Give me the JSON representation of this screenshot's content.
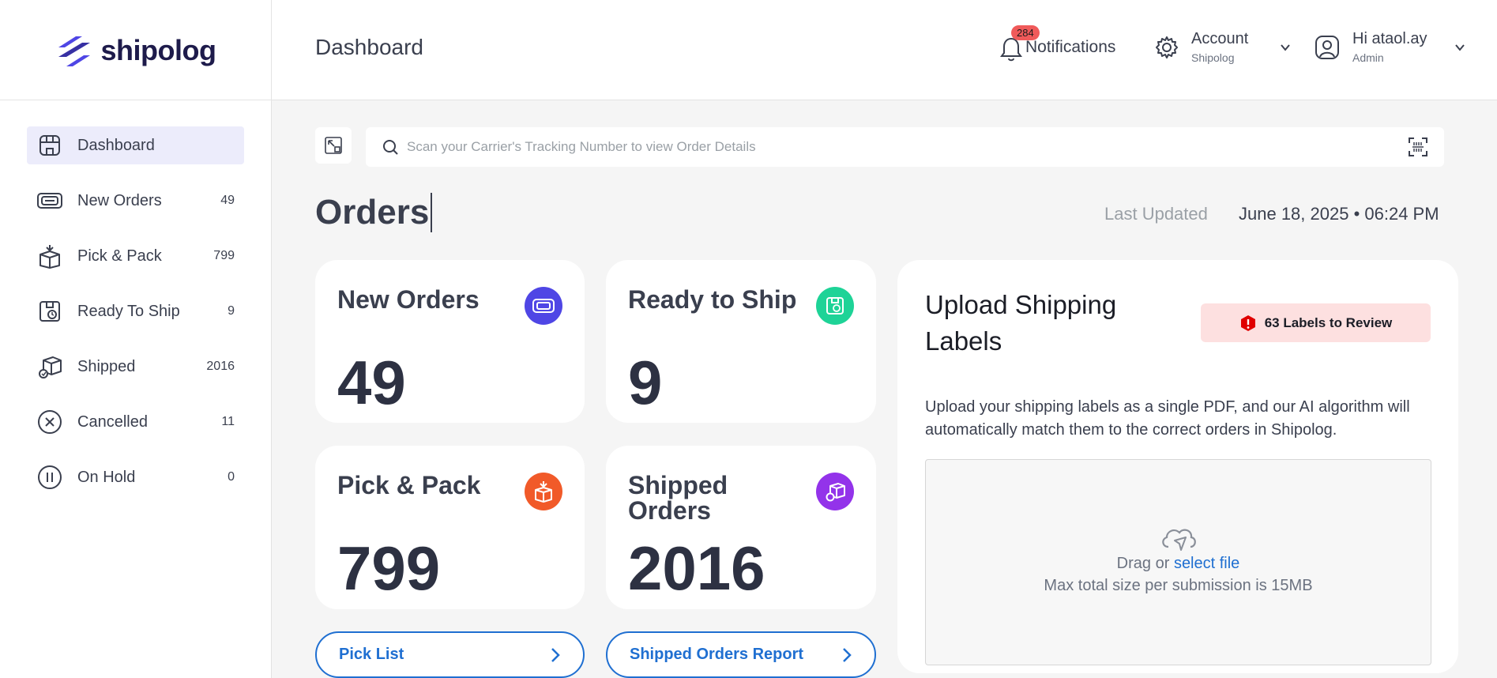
{
  "brand": {
    "name": "shipolog"
  },
  "header": {
    "title": "Dashboard",
    "notifications": {
      "count": "284",
      "label": "Notifications"
    },
    "account": {
      "label": "Account",
      "sub": "Shipolog"
    },
    "user": {
      "greeting": "Hi ataol.ay",
      "role": "Admin"
    }
  },
  "sidebar": {
    "items": [
      {
        "label": "Dashboard",
        "count": "",
        "icon": "store-icon"
      },
      {
        "label": "New Orders",
        "count": "49",
        "icon": "ticket-icon"
      },
      {
        "label": "Pick & Pack",
        "count": "799",
        "icon": "box-icon"
      },
      {
        "label": "Ready To Ship",
        "count": "9",
        "icon": "clock-box-icon"
      },
      {
        "label": "Shipped",
        "count": "2016",
        "icon": "shipped-box-icon"
      },
      {
        "label": "Cancelled",
        "count": "11",
        "icon": "x-circle-icon"
      },
      {
        "label": "On Hold",
        "count": "0",
        "icon": "pause-circle-icon"
      }
    ]
  },
  "search": {
    "placeholder": "Scan your Carrier's Tracking Number to view Order Details"
  },
  "orders": {
    "heading": "Orders",
    "last_updated_label": "Last Updated",
    "last_updated_value": "June 18, 2025 • 06:24 PM",
    "cards": [
      {
        "title": "New Orders",
        "value": "49",
        "color": "#4f46e5"
      },
      {
        "title": "Ready to Ship",
        "value": "9",
        "color": "#1ed397"
      },
      {
        "title": "Pick & Pack",
        "value": "799",
        "color": "#f15a29"
      },
      {
        "title": "Shipped Orders",
        "value": "2016",
        "color": "#9333ea"
      }
    ],
    "links": [
      {
        "label": "Pick List"
      },
      {
        "label": "Shipped Orders Report"
      }
    ]
  },
  "upload": {
    "title": "Upload Shipping Labels",
    "review_label": "63 Labels to Review",
    "description": "Upload your shipping labels as a single PDF, and our AI algorithm will automatically match them to the correct orders in Shipolog.",
    "drag_text": "Drag or",
    "select_text": "select file",
    "max_text": "Max total size per submission is 15MB"
  },
  "colors": {
    "accent": "#1f6fd1",
    "brand": "#1e1b4b",
    "badge": "#f05a5a"
  }
}
